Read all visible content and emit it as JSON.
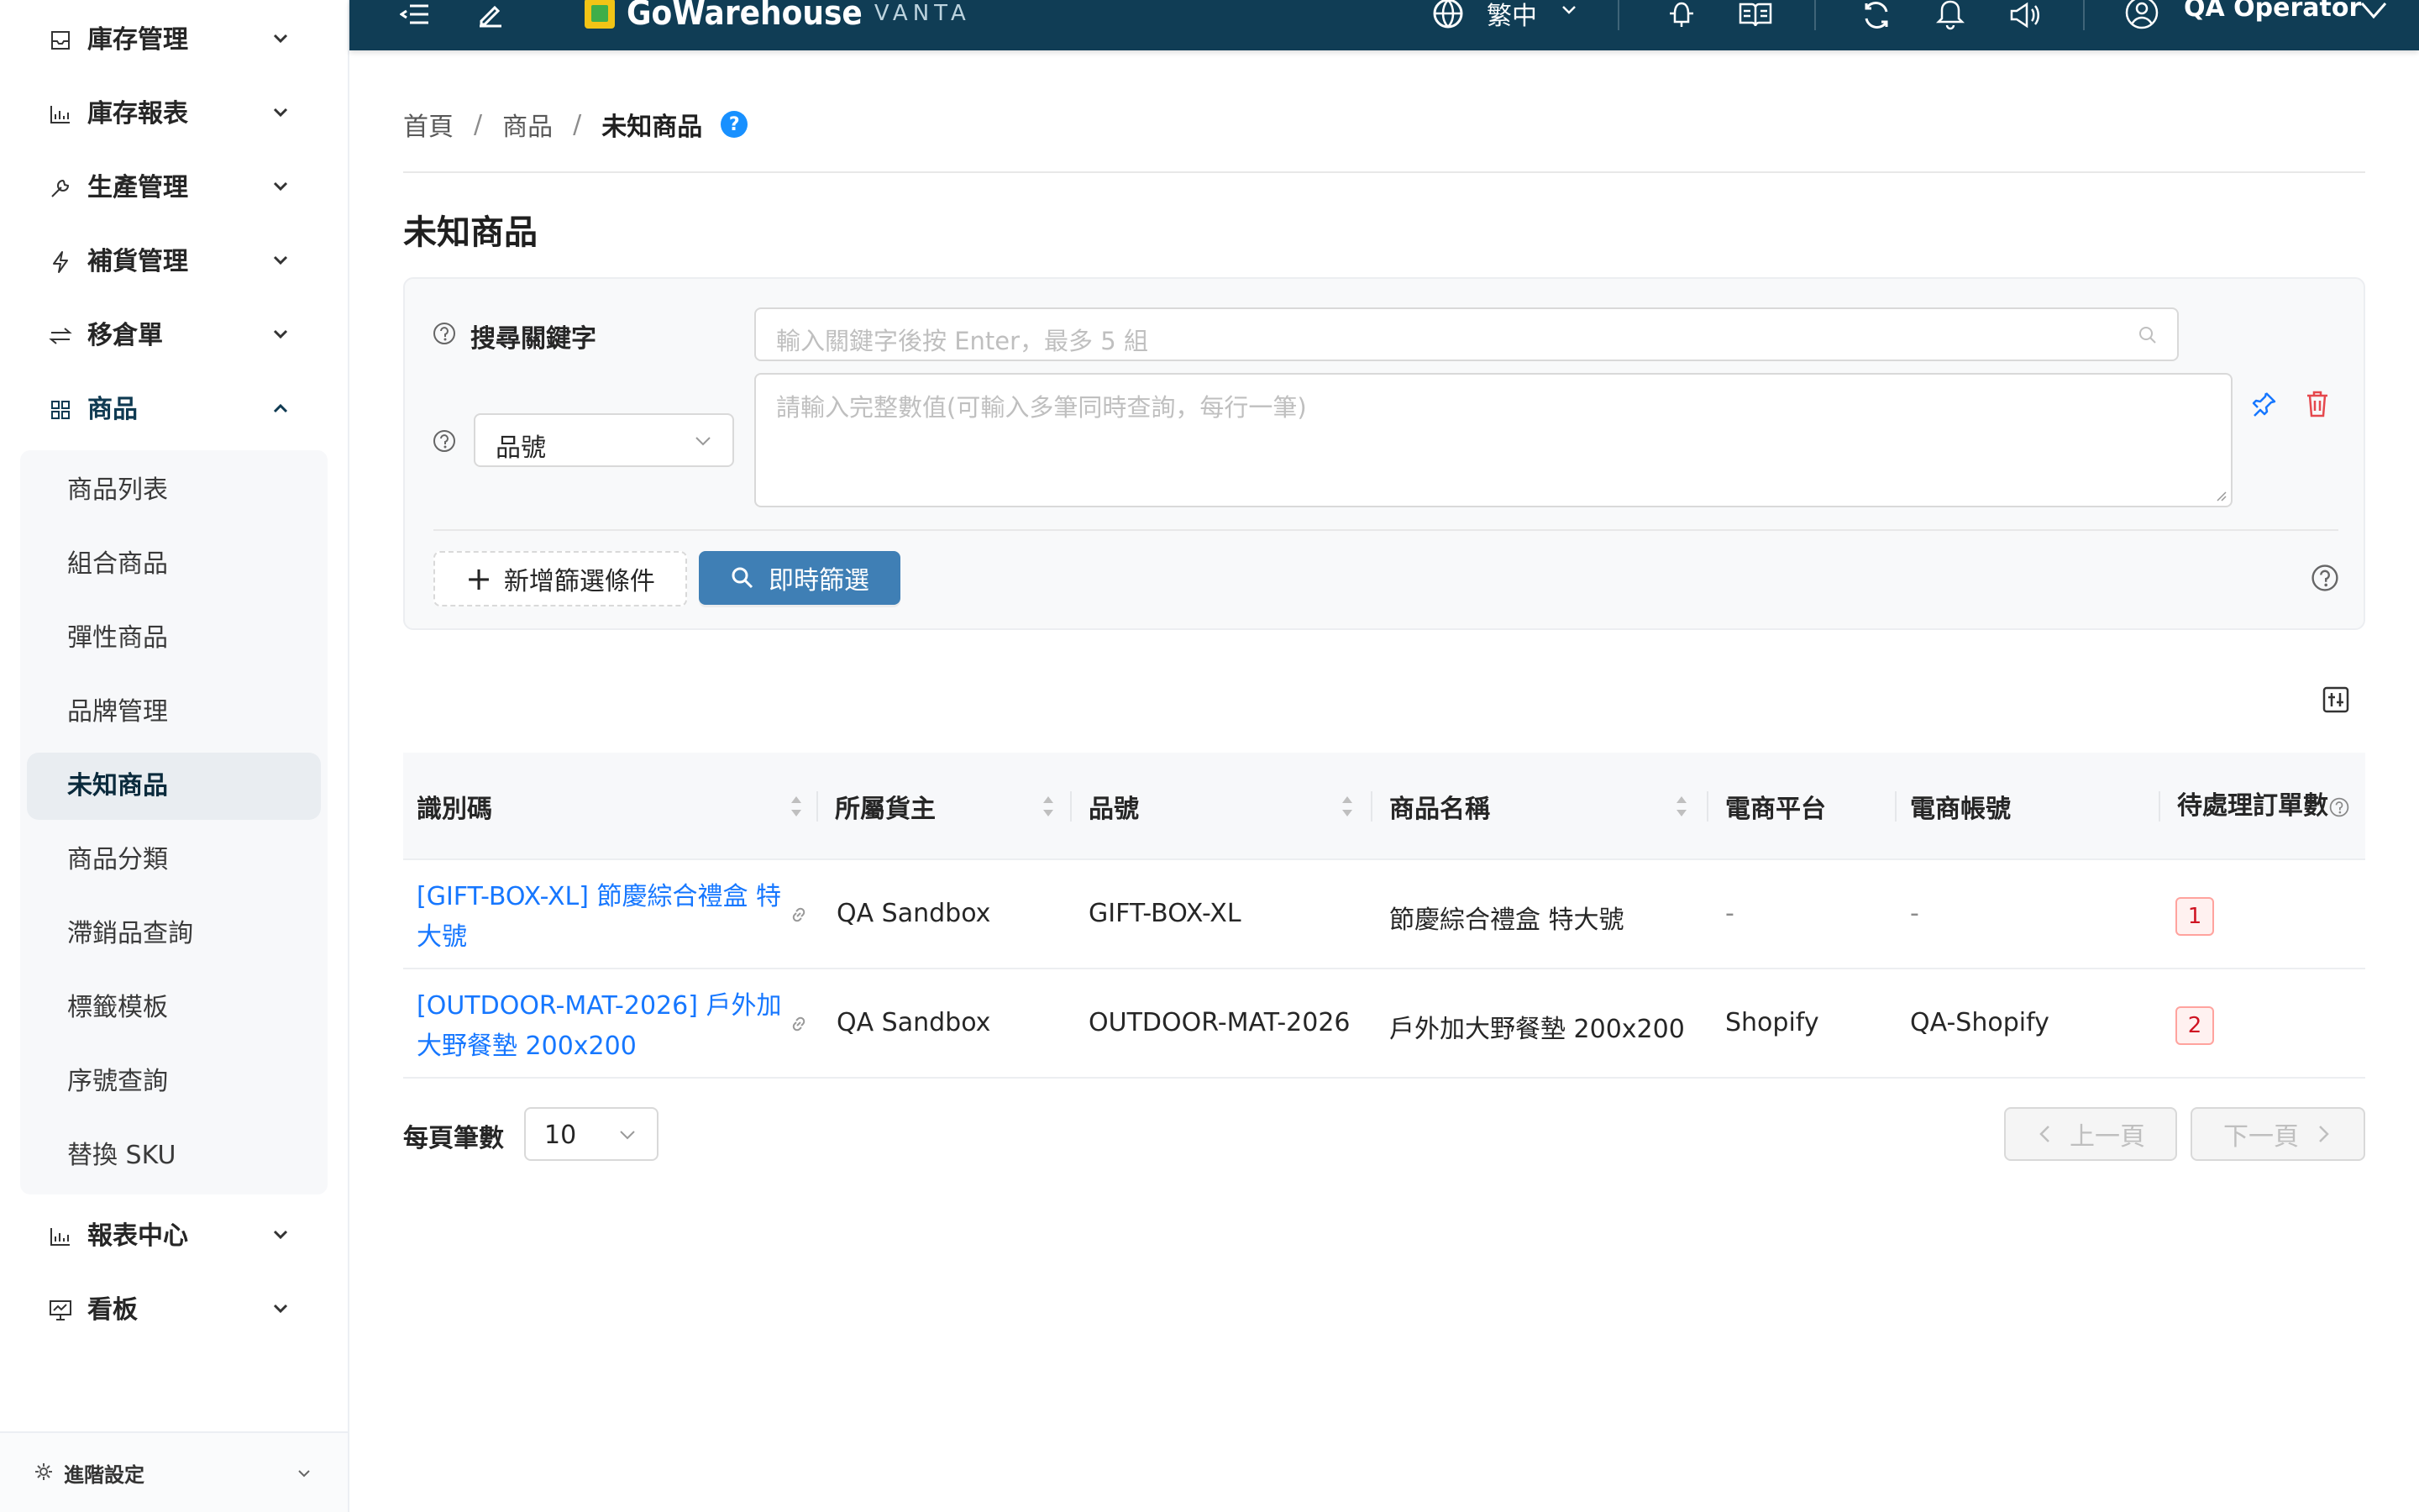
{
  "topbar": {
    "brand_name": "GoWarehouse",
    "brand_sub": "VANTA",
    "language": "繁中",
    "user_name": "QA Operator"
  },
  "sidebar": {
    "items": [
      {
        "label": "庫存管理",
        "icon": "inbox-icon"
      },
      {
        "label": "庫存報表",
        "icon": "bar-chart-icon"
      },
      {
        "label": "生產管理",
        "icon": "wrench-icon"
      },
      {
        "label": "補貨管理",
        "icon": "lightning-icon"
      },
      {
        "label": "移倉單",
        "icon": "transfer-icon"
      },
      {
        "label": "商品",
        "icon": "grid-icon"
      }
    ],
    "submenu": [
      "商品列表",
      "組合商品",
      "彈性商品",
      "品牌管理",
      "未知商品",
      "商品分類",
      "滯銷品查詢",
      "標籤模板",
      "序號查詢",
      "替換 SKU"
    ],
    "active_submenu": "未知商品",
    "bottom_items": [
      {
        "label": "報表中心",
        "icon": "bar-chart-icon"
      },
      {
        "label": "看板",
        "icon": "dashboard-icon"
      }
    ],
    "advanced_settings": "進階設定"
  },
  "breadcrumb": {
    "home": "首頁",
    "section": "商品",
    "current": "未知商品",
    "help": "?"
  },
  "page": {
    "title": "未知商品"
  },
  "filters": {
    "keyword_label": "搜尋關鍵字",
    "keyword_placeholder": "輸入關鍵字後按 Enter，最多 5 組",
    "field_select_value": "品號",
    "value_placeholder": "請輸入完整數值(可輸入多筆同時查詢，每行一筆)",
    "add_condition": "新增篩選條件",
    "instant_filter": "即時篩選"
  },
  "table": {
    "columns": [
      "識別碼",
      "所屬貨主",
      "品號",
      "商品名稱",
      "電商平台",
      "電商帳號",
      "待處理訂單數"
    ],
    "rows": [
      {
        "id": "[GIFT-BOX-XL] 節慶綜合禮盒 特大號",
        "owner": "QA Sandbox",
        "sku": "GIFT-BOX-XL",
        "name": "節慶綜合禮盒 特大號",
        "platform": "-",
        "account": "-",
        "pending": "1"
      },
      {
        "id": "[OUTDOOR-MAT-2026] 戶外加大野餐墊 200x200",
        "owner": "QA Sandbox",
        "sku": "OUTDOOR-MAT-2026",
        "name": "戶外加大野餐墊 200x200",
        "platform": "Shopify",
        "account": "QA-Shopify",
        "pending": "2"
      }
    ]
  },
  "pagination": {
    "page_size_label": "每頁筆數",
    "page_size": "10",
    "prev": "上一頁",
    "next": "下一頁"
  },
  "colors": {
    "topbar_bg": "#103d55",
    "primary_button": "#3f7fb5",
    "link": "#1677ff",
    "danger": "#e5484d",
    "help_badge": "#1890ff"
  }
}
